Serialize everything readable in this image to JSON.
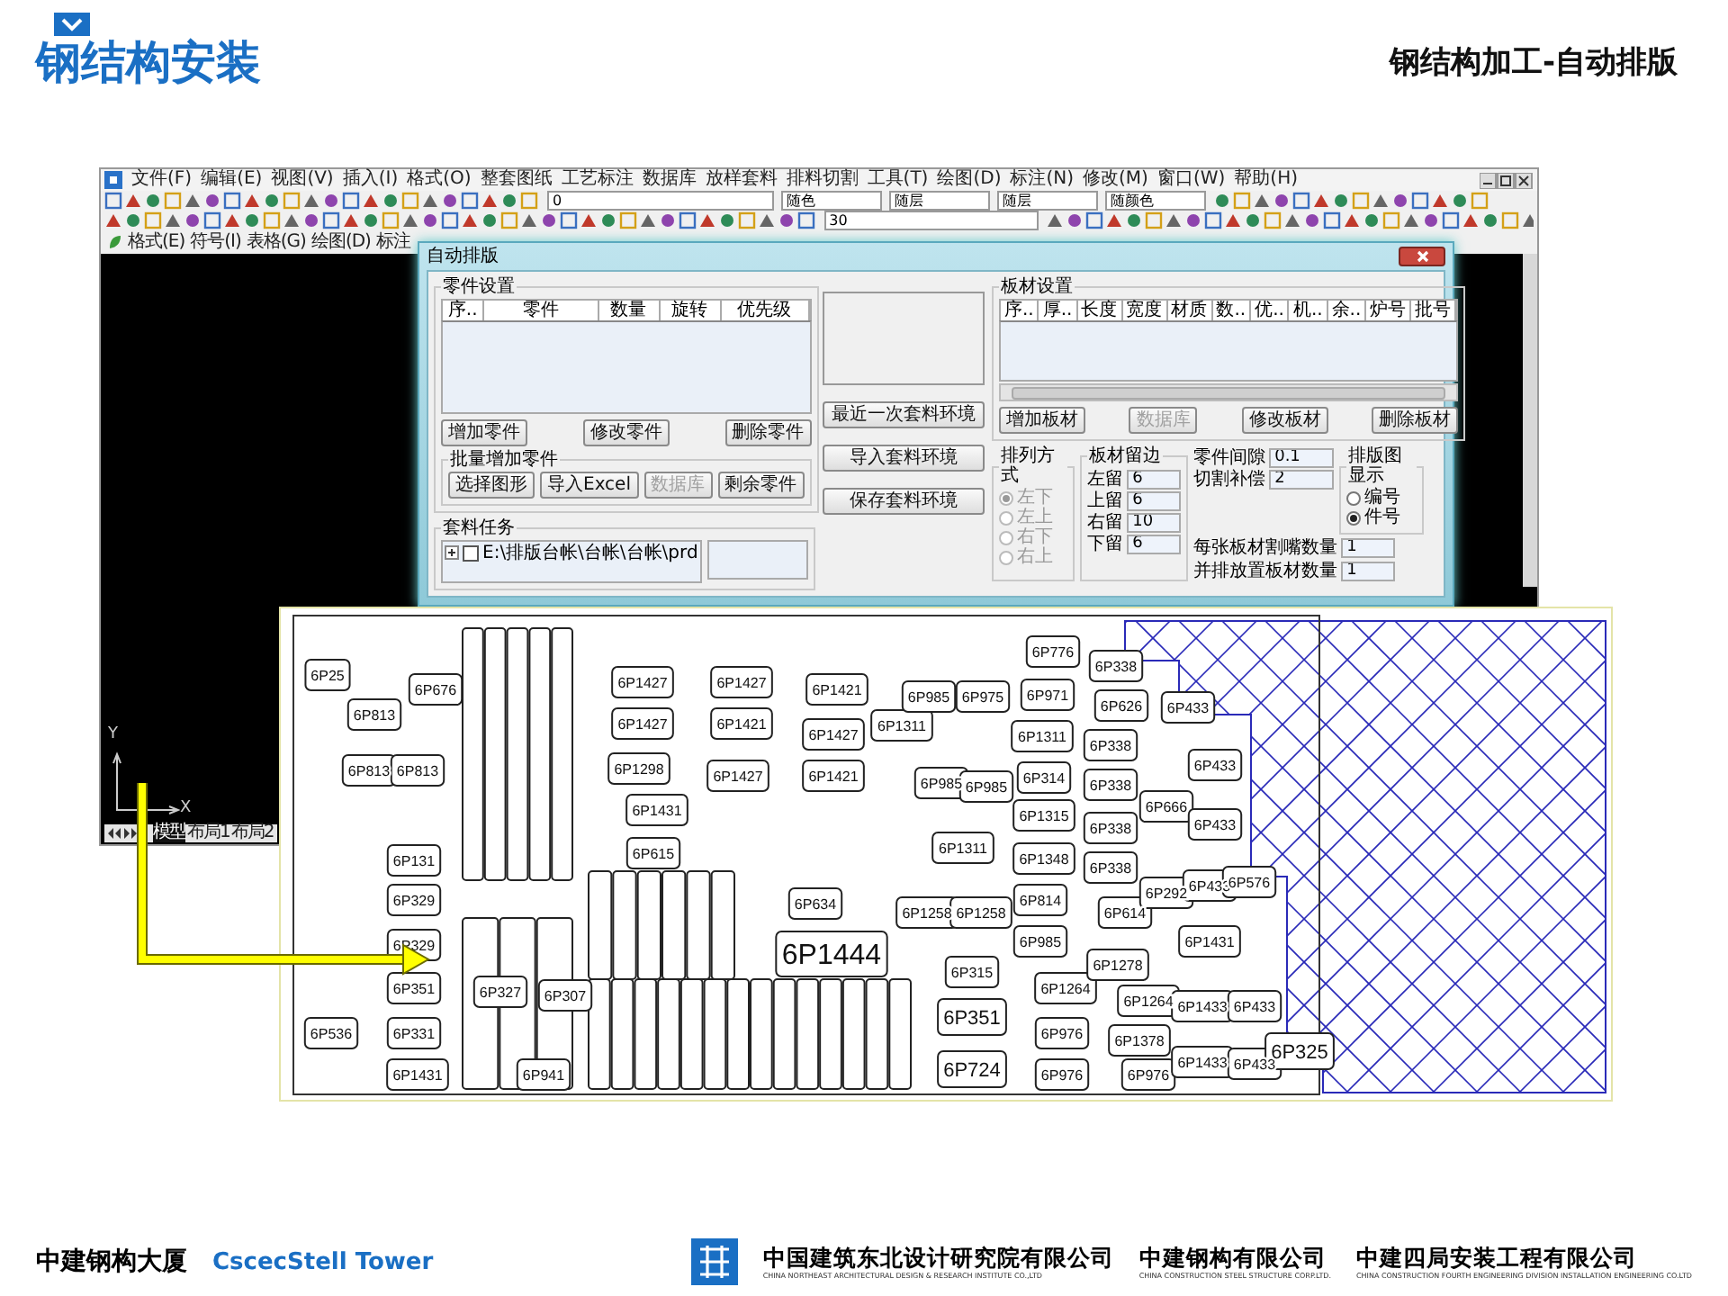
{
  "header": {
    "section_title": "钢结构安装",
    "slide_title": "钢结构加工-自动排版"
  },
  "cad_window": {
    "menus": [
      "文件(F)",
      "编辑(E)",
      "视图(V)",
      "插入(I)",
      "格式(O)",
      "整套图纸",
      "工艺标注",
      "数据库",
      "放样套料",
      "排料切割",
      "工具(T)",
      "绘图(D)",
      "标注(N)",
      "修改(M)",
      "窗口(W)",
      "帮助(H)"
    ],
    "toolbar1_combos": [
      "0",
      "随色",
      "随层",
      "随层",
      "随颜色"
    ],
    "toolbar2_combos": [
      "30"
    ],
    "secondary_menus": [
      "格式(E)",
      "符号(I)",
      "表格(G)",
      "绘图(D)",
      "标注"
    ],
    "axis_labels": [
      "Y",
      "X"
    ],
    "layout_tabs": [
      {
        "label": "模型",
        "selected": true
      },
      {
        "label": "布局1",
        "selected": false
      },
      {
        "label": "布局2",
        "selected": false
      }
    ]
  },
  "dialog": {
    "title": "自动排版",
    "parts_group": {
      "title": "零件设置",
      "columns": [
        "序..",
        "零件",
        "数量",
        "旋转",
        "优先级"
      ],
      "buttons": [
        {
          "label": "增加零件",
          "disabled": false
        },
        {
          "label": "修改零件",
          "disabled": false
        },
        {
          "label": "删除零件",
          "disabled": false
        }
      ],
      "batch_title": "批量增加零件",
      "batch_buttons": [
        {
          "label": "选择图形",
          "disabled": false
        },
        {
          "label": "导入Excel",
          "disabled": false
        },
        {
          "label": "数据库",
          "disabled": true
        },
        {
          "label": "剩余零件",
          "disabled": false
        }
      ]
    },
    "env_buttons": [
      "最近一次套料环境",
      "导入套料环境",
      "保存套料环境"
    ],
    "plates_group": {
      "title": "板材设置",
      "columns": [
        "序..",
        "厚..",
        "长度",
        "宽度",
        "材质",
        "数..",
        "优..",
        "机..",
        "余..",
        "炉号",
        "批号"
      ],
      "buttons": [
        {
          "label": "增加板材",
          "disabled": false
        },
        {
          "label": "数据库",
          "disabled": true
        },
        {
          "label": "修改板材",
          "disabled": false
        },
        {
          "label": "删除板材",
          "disabled": false
        }
      ]
    },
    "arrange_group": {
      "title": "排列方式",
      "disabled": true,
      "options": [
        {
          "label": "左下",
          "selected": true
        },
        {
          "label": "左上",
          "selected": false
        },
        {
          "label": "右下",
          "selected": false
        },
        {
          "label": "右上",
          "selected": false
        }
      ]
    },
    "margin_group": {
      "title": "板材留边",
      "fields": [
        {
          "label": "左留",
          "value": "6"
        },
        {
          "label": "上留",
          "value": "6"
        },
        {
          "label": "右留",
          "value": "10"
        },
        {
          "label": "下留",
          "value": "6"
        }
      ]
    },
    "gap_fields": [
      {
        "label": "零件间隙",
        "value": "0.1"
      },
      {
        "label": "切割补偿",
        "value": "2"
      }
    ],
    "display_group": {
      "title": "排版图显示",
      "options": [
        {
          "label": "编号",
          "selected": false
        },
        {
          "label": "件号",
          "selected": true
        }
      ]
    },
    "count_fields": [
      {
        "label": "每张板材割嘴数量",
        "value": "1"
      },
      {
        "label": "并排放置板材数量",
        "value": "1"
      }
    ],
    "task_group": {
      "title": "套料任务",
      "items": [
        {
          "label": "E:\\排版台帐\\台帐\\台帐\\prd",
          "checked": false
        }
      ]
    }
  },
  "nesting_drawing": {
    "part_labels": [
      "6P25",
      "6P676",
      "6P813",
      "6P813",
      "6P813",
      "6P131",
      "6P329",
      "6P329",
      "6P351",
      "6P536",
      "6P331",
      "6P1431",
      "6P327",
      "6P307",
      "6P941",
      "6P1427",
      "6P1427",
      "6P1421",
      "6P1427",
      "6P1421",
      "6P1427",
      "6P1298",
      "6P1427",
      "6P1421",
      "6P1431",
      "6P615",
      "6P634",
      "6P1444",
      "6P351",
      "6P724",
      "6P1311",
      "6P985",
      "6P975",
      "6P985",
      "6P985",
      "6P1311",
      "6P1258",
      "6P1258",
      "6P315",
      "6P776",
      "6P971",
      "6P1311",
      "6P314",
      "6P1315",
      "6P1348",
      "6P814",
      "6P985",
      "6P1264",
      "6P976",
      "6P976",
      "6P338",
      "6P626",
      "6P338",
      "6P338",
      "6P338",
      "6P338",
      "6P614",
      "6P1278",
      "6P1264",
      "6P1378",
      "6P976",
      "6P433",
      "6P433",
      "6P666",
      "6P433",
      "6P292",
      "6P433",
      "6P576",
      "6P1431",
      "6P1433",
      "6P433",
      "6P1433",
      "6P433",
      "6P325"
    ]
  },
  "footer": {
    "building": "中建钢构大厦",
    "building_en": "CscecStell Tower",
    "companies": [
      {
        "name": "中国建筑东北设计研究院有限公司",
        "name_en": "CHINA NORTHEAST ARCHITECTURAL DESIGN & RESEARCH INSTITUTE CO.,LTD"
      },
      {
        "name": "中建钢构有限公司",
        "name_en": "CHINA CONSTRUCTION STEEL STRUCTURE CORP.LTD."
      },
      {
        "name": "中建四局安装工程有限公司",
        "name_en": "CHINA CONSTRUCTION FOURTH ENGINEERING DIVISION INSTALLATION ENGINEERING CO.LTD"
      }
    ]
  }
}
